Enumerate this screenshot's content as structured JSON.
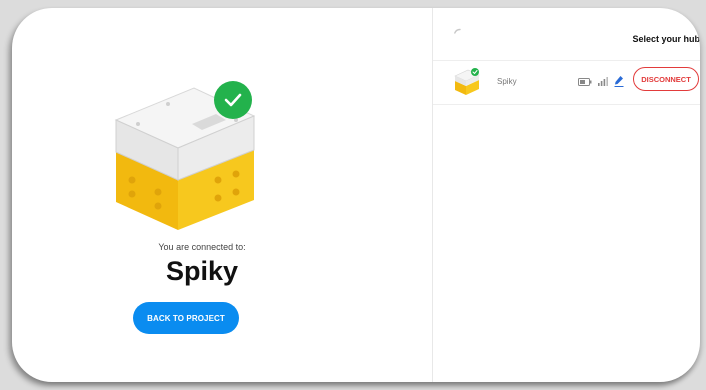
{
  "left": {
    "connected_label": "You are connected to:",
    "hub_name": "Spiky",
    "back_button_label": "BACK TO PROJECT"
  },
  "right": {
    "title": "Select your hub",
    "hubs": [
      {
        "name": "Spiky",
        "disconnect_label": "DISCONNECT",
        "connected": true
      }
    ]
  },
  "icons": {
    "check": "check-icon",
    "spinner": "spinner-icon",
    "battery": "battery-icon",
    "signal": "signal-icon",
    "edit": "pencil-icon"
  },
  "colors": {
    "accent_blue": "#0a8cf0",
    "success_green": "#23b24c",
    "danger_red": "#e23b3b",
    "hub_yellow": "#f7c81e",
    "hub_white": "#f2f2f2"
  }
}
